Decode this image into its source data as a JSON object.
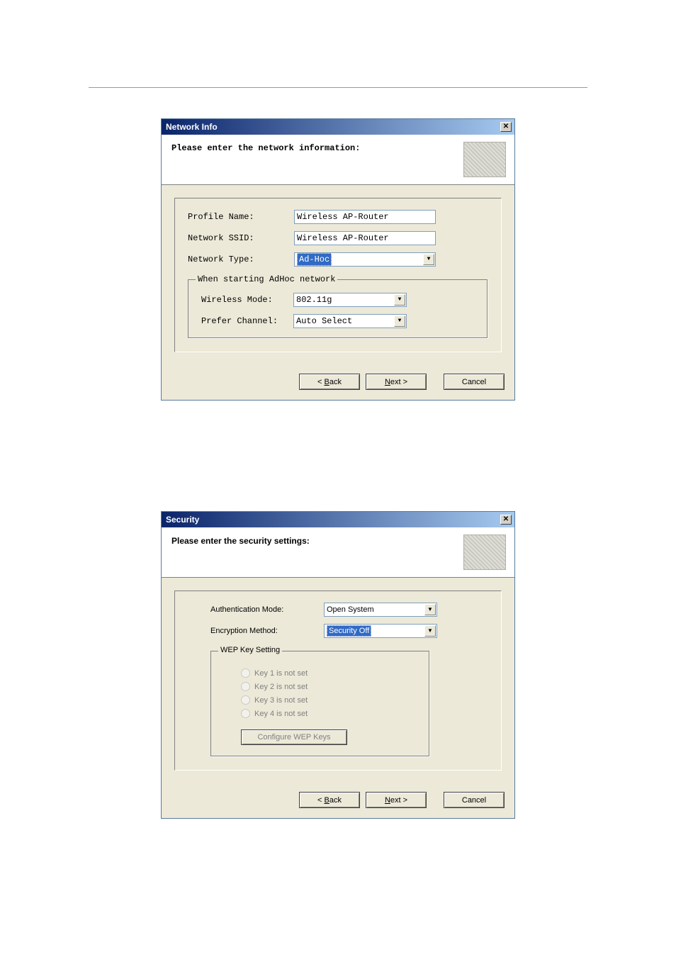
{
  "dialog1": {
    "title": "Network Info",
    "heading": "Please enter the network information:",
    "labels": {
      "profile_name": "Profile Name:",
      "network_ssid": "Network SSID:",
      "network_type": "Network Type:"
    },
    "fields": {
      "profile_name": "Wireless AP-Router",
      "network_ssid": "Wireless AP-Router",
      "network_type": "Ad-Hoc"
    },
    "group": {
      "legend": "When starting AdHoc network",
      "labels": {
        "wireless_mode": "Wireless Mode:",
        "prefer_channel": "Prefer Channel:"
      },
      "fields": {
        "wireless_mode": "802.11g",
        "prefer_channel": "Auto Select"
      }
    }
  },
  "dialog2": {
    "title": "Security",
    "heading": "Please enter the security settings:",
    "labels": {
      "auth_mode": "Authentication Mode:",
      "enc_method": "Encryption Method:"
    },
    "fields": {
      "auth_mode": "Open System",
      "enc_method": "Security Off"
    },
    "wep": {
      "legend": "WEP Key Setting",
      "keys": [
        "Key 1 is not set",
        "Key 2 is not set",
        "Key 3 is not set",
        "Key 4 is not set"
      ],
      "configure": "Configure WEP Keys"
    }
  },
  "buttons": {
    "back": "ack",
    "back_prefix": "< ",
    "back_ac": "B",
    "next": "ext >",
    "next_ac": "N",
    "cancel": "Cancel"
  }
}
